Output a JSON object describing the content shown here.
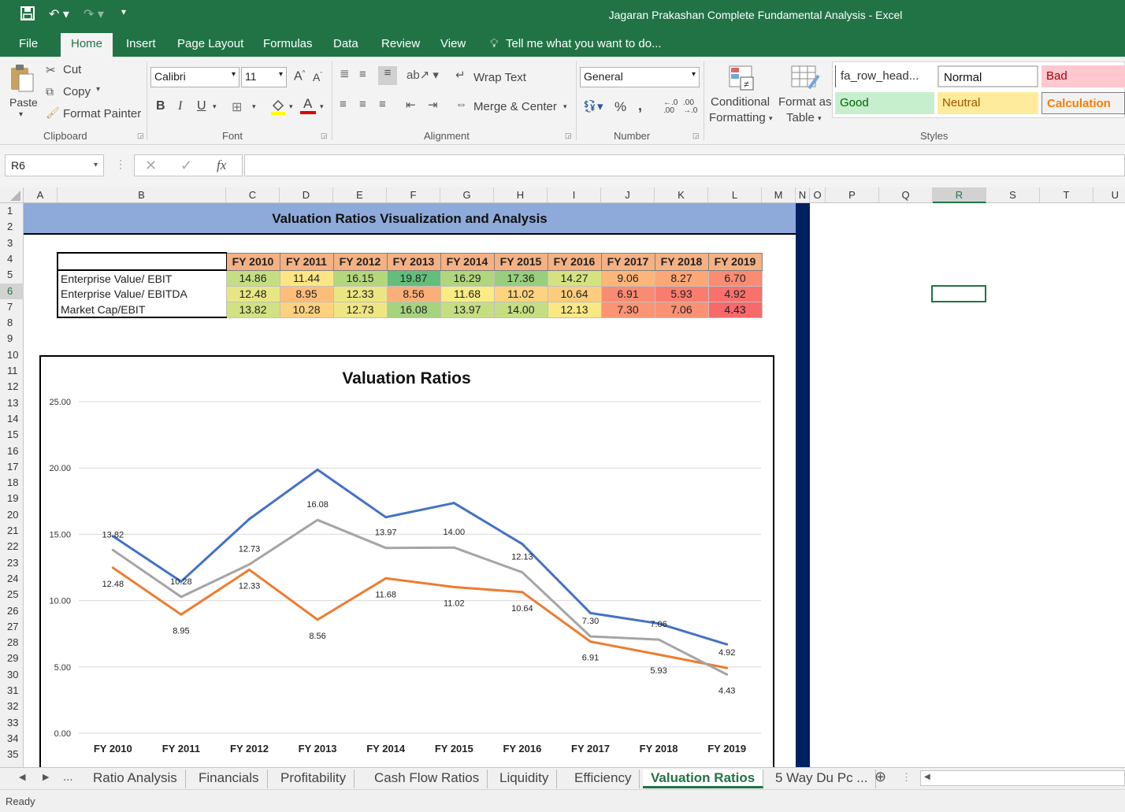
{
  "window": {
    "title": "Jagaran Prakashan Complete Fundamental Analysis - Excel"
  },
  "menu": {
    "tabs": [
      "File",
      "Home",
      "Insert",
      "Page Layout",
      "Formulas",
      "Data",
      "Review",
      "View"
    ],
    "tell_me": "Tell me what you want to do..."
  },
  "ribbon": {
    "clipboard": {
      "paste": "Paste",
      "cut": "Cut",
      "copy": "Copy",
      "format_painter": "Format Painter",
      "label": "Clipboard"
    },
    "font": {
      "name": "Calibri",
      "size": "11",
      "bold": "B",
      "italic": "I",
      "underline": "U",
      "label": "Font"
    },
    "alignment": {
      "wrap": "Wrap Text",
      "merge": "Merge & Center",
      "label": "Alignment"
    },
    "number": {
      "format": "General",
      "percent": "%",
      "comma": ",",
      "label": "Number"
    },
    "styles": {
      "conditional": "Conditional",
      "conditional2": "Formatting",
      "format_as": "Format as",
      "format_as2": "Table",
      "fa_row_head": "fa_row_head...",
      "normal": "Normal",
      "bad": "Bad",
      "good": "Good",
      "neutral": "Neutral",
      "calculation": "Calculation",
      "label": "Styles"
    }
  },
  "formula_bar": {
    "name_box": "R6",
    "fx": "fx",
    "value": ""
  },
  "columns": [
    "A",
    "B",
    "C",
    "D",
    "E",
    "F",
    "G",
    "H",
    "I",
    "J",
    "K",
    "L",
    "M",
    "N",
    "O",
    "P",
    "Q",
    "R",
    "S",
    "T",
    "U"
  ],
  "rows": [
    "1",
    "2",
    "3",
    "4",
    "5",
    "6",
    "7",
    "8",
    "9",
    "10",
    "11",
    "12",
    "13",
    "14",
    "15",
    "16",
    "17",
    "18",
    "19",
    "20",
    "21",
    "22",
    "23",
    "24",
    "25",
    "26",
    "27",
    "28",
    "29",
    "30",
    "31",
    "32",
    "33",
    "34",
    "35"
  ],
  "sheet": {
    "banner": "Valuation Ratios Visualization and Analysis",
    "table": {
      "years": [
        "FY 2010",
        "FY 2011",
        "FY 2012",
        "FY 2013",
        "FY 2014",
        "FY 2015",
        "FY 2016",
        "FY 2017",
        "FY 2018",
        "FY 2019"
      ],
      "rows": [
        {
          "label": "Enterprise Value/ EBIT",
          "values": [
            "14.86",
            "11.44",
            "16.15",
            "19.87",
            "16.29",
            "17.36",
            "14.27",
            "9.06",
            "8.27",
            "6.70"
          ]
        },
        {
          "label": "Enterprise Value/ EBITDA",
          "values": [
            "12.48",
            "8.95",
            "12.33",
            "8.56",
            "11.68",
            "11.02",
            "10.64",
            "6.91",
            "5.93",
            "4.92"
          ]
        },
        {
          "label": "Market Cap/EBIT",
          "values": [
            "13.82",
            "10.28",
            "12.73",
            "16.08",
            "13.97",
            "14.00",
            "12.13",
            "7.30",
            "7.06",
            "4.43"
          ]
        }
      ],
      "cell_colors": [
        [
          "#c5de82",
          "#fde583",
          "#b4d77e",
          "#63be7b",
          "#b0d67e",
          "#98cf7e",
          "#d5e282",
          "#fcb679",
          "#fba776",
          "#f98c73"
        ],
        [
          "#e8e683",
          "#fdbd7a",
          "#ebe683",
          "#fbaf78",
          "#fbeb84",
          "#fed380",
          "#fccd7e",
          "#f98b72",
          "#f97d6f",
          "#f8716c"
        ],
        [
          "#d2e182",
          "#fed17f",
          "#efe683",
          "#a5d37e",
          "#c6de82",
          "#c5de82",
          "#f9e884",
          "#fa9474",
          "#fa9173",
          "#f8696b"
        ]
      ]
    }
  },
  "chart_data": {
    "type": "line",
    "title": "Valuation Ratios",
    "categories": [
      "FY 2010",
      "FY 2011",
      "FY 2012",
      "FY 2013",
      "FY 2014",
      "FY 2015",
      "FY 2016",
      "FY 2017",
      "FY 2018",
      "FY 2019"
    ],
    "ylim": [
      0,
      25
    ],
    "yticks": [
      "0.00",
      "5.00",
      "10.00",
      "15.00",
      "20.00",
      "25.00"
    ],
    "grid": true,
    "series": [
      {
        "values": [
          14.86,
          11.44,
          16.15,
          19.87,
          16.29,
          17.36,
          14.27,
          9.06,
          8.27,
          6.7
        ],
        "color": "#4472c4",
        "labels": false
      },
      {
        "values": [
          12.48,
          8.95,
          12.33,
          8.56,
          11.68,
          11.02,
          10.64,
          6.91,
          5.93,
          4.92
        ],
        "color": "#ed7d31",
        "labels": true
      },
      {
        "values": [
          13.82,
          10.28,
          12.73,
          16.08,
          13.97,
          14.0,
          12.13,
          7.3,
          7.06,
          4.43
        ],
        "color": "#a5a5a5",
        "labels": true
      }
    ]
  },
  "sheet_tabs": [
    "Ratio Analysis",
    "Financials",
    "Profitability",
    "Cash Flow Ratios",
    "Liquidity",
    "Efficiency",
    "Valuation Ratios",
    "5 Way Du Pc ..."
  ],
  "active_sheet": "Valuation Ratios",
  "tab_nav": {
    "more": "..."
  },
  "status": {
    "text": "Ready"
  }
}
